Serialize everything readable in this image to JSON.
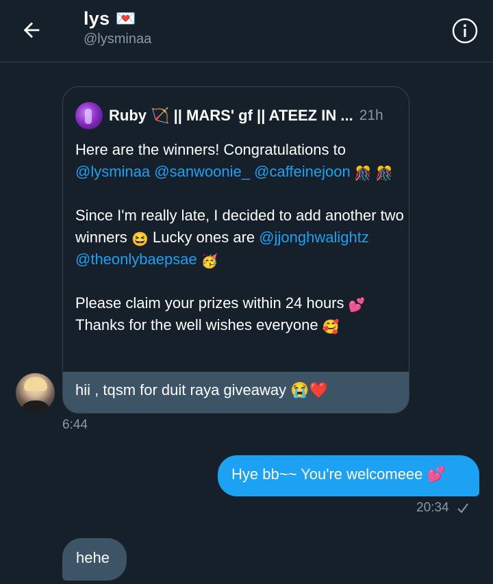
{
  "header": {
    "name": "lys",
    "handle": "@lysminaa",
    "name_emoji": "💌"
  },
  "quoted_tweet": {
    "author": "Ruby 🏹 || MARS' gf || ATEEZ IN ...",
    "time": "21h",
    "paragraphs": {
      "p1_text": "Here are the winners! Congratulations to",
      "p1_mentions": "@lysminaa @sanwoonie_ @caffeinejoon",
      "p1_emoji": "🎊",
      "p2_text_a": "Since I'm really late, I  decided to add another two winners",
      "p2_emoji_a": "😆",
      "p2_text_b": "Lucky ones are",
      "p2_mentions": "@jjonghwalightz @theonlybaepsae",
      "p2_emoji_b": "🥳",
      "p3_text_a": "Please claim your prizes within 24 hours",
      "p3_emoji_a": "💕",
      "p3_text_b": "Thanks for the well wishes everyone",
      "p3_emoji_b": "🥰"
    }
  },
  "messages": {
    "incoming_1": "hii , tqsm for duit raya giveaway 😭❤️",
    "incoming_1_time": "6:44",
    "outgoing_1": "Hye bb~~ You're welcomeee 💕",
    "outgoing_1_time": "20:34",
    "incoming_2": "hehe"
  },
  "colors": {
    "background": "#15202b",
    "accent": "#1da1f2",
    "bubble_incoming": "#3d5466",
    "muted_text": "#8899a6",
    "border": "#38444d"
  },
  "icons": {
    "back": "arrow-left-icon",
    "info": "info-circle-icon",
    "read": "checkmark-icon"
  }
}
